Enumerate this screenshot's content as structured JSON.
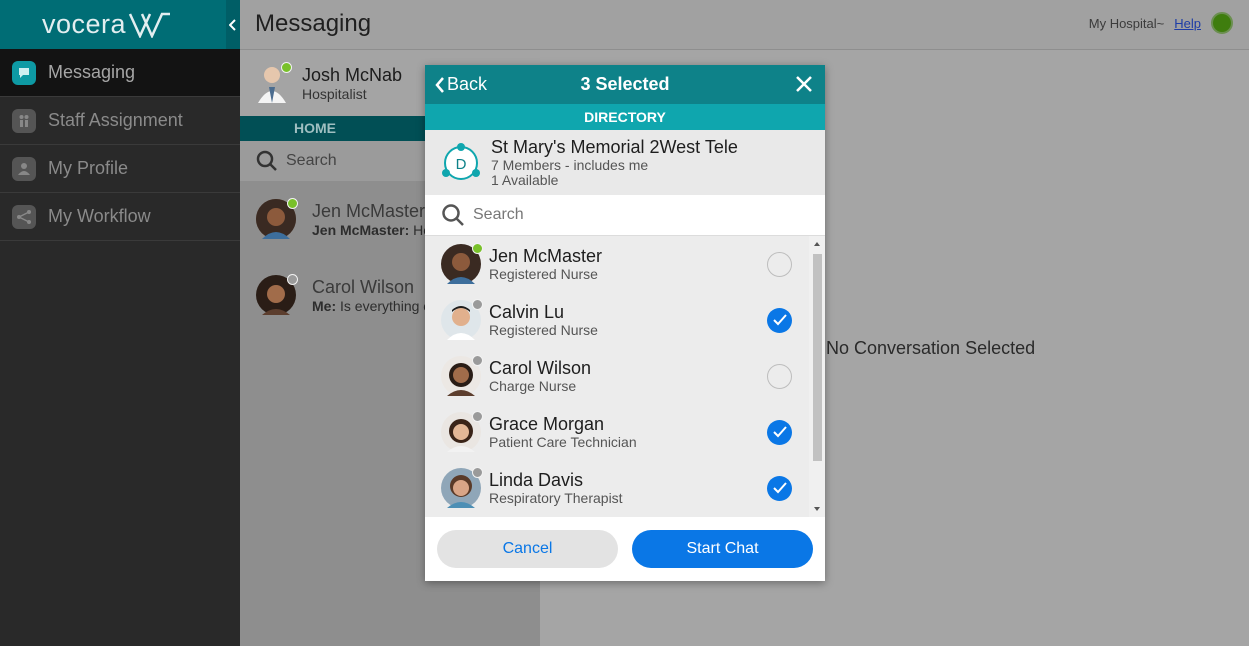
{
  "sidebar": {
    "brand": "vocera",
    "items": [
      {
        "label": "Messaging",
        "icon": "chat-bubble-icon",
        "active": true
      },
      {
        "label": "Staff Assignment",
        "icon": "staff-icon",
        "active": false
      },
      {
        "label": "My Profile",
        "icon": "person-icon",
        "active": false
      },
      {
        "label": "My Workflow",
        "icon": "workflow-icon",
        "active": false
      }
    ]
  },
  "header": {
    "title": "Messaging",
    "hospital": "My Hospital~",
    "help": "Help",
    "status_color": "#3f7d0e"
  },
  "conversations": {
    "me": {
      "name": "Josh McNab",
      "role": "Hospitalist"
    },
    "home_tab": "HOME",
    "search_placeholder": "Search",
    "items": [
      {
        "name": "Jen McMaster",
        "preview_sender": "Jen McMaster:",
        "preview_text": " He"
      },
      {
        "name": "Carol Wilson",
        "preview_sender": "Me:",
        "preview_text": " Is everything o"
      }
    ]
  },
  "main": {
    "empty_text": "No Conversation Selected"
  },
  "modal": {
    "back": "Back",
    "title": "3 Selected",
    "directory": "DIRECTORY",
    "group": {
      "initial": "D",
      "name": "St Mary's Memorial 2West Tele",
      "members": "7 Members - includes me",
      "available": "1 Available"
    },
    "search_placeholder": "Search",
    "people": [
      {
        "name": "Jen McMaster",
        "role": "Registered Nurse",
        "selected": false,
        "online": true
      },
      {
        "name": "Calvin Lu",
        "role": "Registered Nurse",
        "selected": true,
        "online": false
      },
      {
        "name": "Carol Wilson",
        "role": "Charge Nurse",
        "selected": false,
        "online": false
      },
      {
        "name": "Grace Morgan",
        "role": "Patient Care Technician",
        "selected": true,
        "online": false
      },
      {
        "name": "Linda Davis",
        "role": "Respiratory Therapist",
        "selected": true,
        "online": false
      }
    ],
    "cancel": "Cancel",
    "start": "Start Chat"
  },
  "colors": {
    "teal_dark": "#0e8289",
    "teal_light": "#0fa6ae",
    "accent_blue": "#0a77e6",
    "online_green": "#79c12a"
  }
}
